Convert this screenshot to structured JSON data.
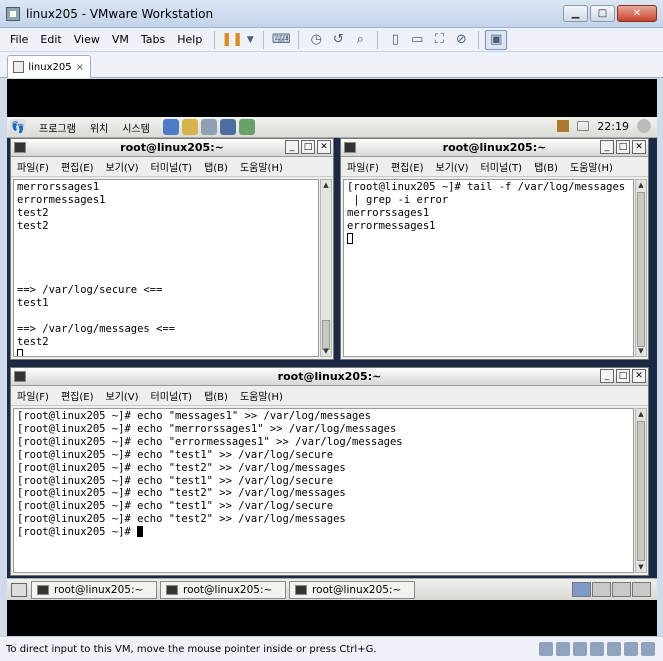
{
  "host": {
    "title": "linux205 - VMware Workstation",
    "menu": [
      "File",
      "Edit",
      "View",
      "VM",
      "Tabs",
      "Help"
    ],
    "tab_label": "linux205",
    "tab_close": "×",
    "status_text": "To direct input to this VM, move the mouse pointer inside or press Ctrl+G."
  },
  "guest_panel": {
    "menus": [
      "프로그램",
      "위치",
      "시스템"
    ],
    "clock": "22:19"
  },
  "terminal_left": {
    "title": "root@linux205:~",
    "menus": [
      "파일(F)",
      "편집(E)",
      "보기(V)",
      "터미널(T)",
      "탭(B)",
      "도움말(H)"
    ],
    "text": "merrorssages1\nerrormessages1\ntest2\ntest2\n\n\n\n\n==> /var/log/secure <==\ntest1\n\n==> /var/log/messages <==\ntest2"
  },
  "terminal_right": {
    "title": "root@linux205:~",
    "menus": [
      "파일(F)",
      "편집(E)",
      "보기(V)",
      "터미널(T)",
      "탭(B)",
      "도움말(H)"
    ],
    "text": "[root@linux205 ~]# tail -f /var/log/messages\n | grep -i error\nmerrorssages1\nerrormessages1"
  },
  "terminal_bottom": {
    "title": "root@linux205:~",
    "menus": [
      "파일(F)",
      "편집(E)",
      "보기(V)",
      "터미널(T)",
      "탭(B)",
      "도움말(H)"
    ],
    "text": "[root@linux205 ~]# echo \"messages1\" >> /var/log/messages\n[root@linux205 ~]# echo \"merrorssages1\" >> /var/log/messages\n[root@linux205 ~]# echo \"errormessages1\" >> /var/log/messages\n[root@linux205 ~]# echo \"test1\" >> /var/log/secure\n[root@linux205 ~]# echo \"test2\" >> /var/log/messages\n[root@linux205 ~]# echo \"test1\" >> /var/log/secure\n[root@linux205 ~]# echo \"test2\" >> /var/log/messages\n[root@linux205 ~]# echo \"test1\" >> /var/log/secure\n[root@linux205 ~]# echo \"test2\" >> /var/log/messages\n[root@linux205 ~]# "
  },
  "taskbar": {
    "tasks": [
      "root@linux205:~",
      "root@linux205:~",
      "root@linux205:~"
    ]
  }
}
